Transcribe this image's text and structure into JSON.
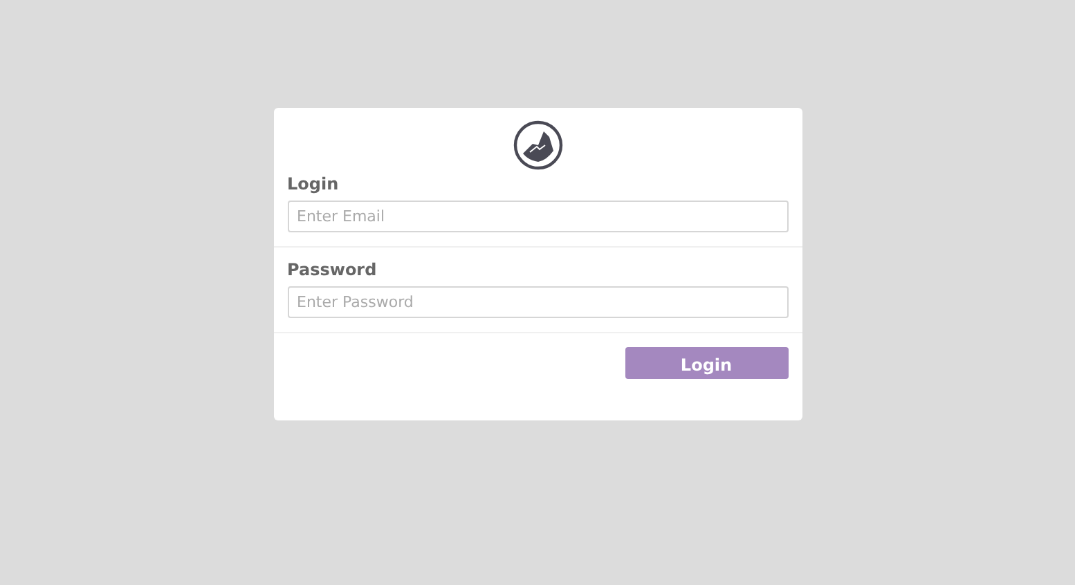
{
  "fields": [
    {
      "label": "Login",
      "placeholder": "Enter Email"
    },
    {
      "label": "Password",
      "placeholder": "Enter Password"
    }
  ],
  "button": {
    "label": "Login"
  }
}
